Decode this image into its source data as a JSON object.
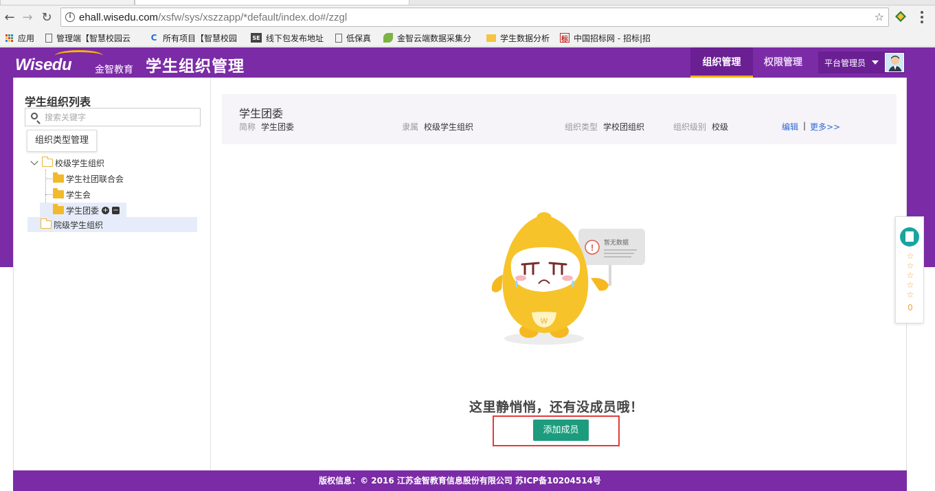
{
  "browser": {
    "url_host": "ehall.wisedu.com",
    "url_path": "/xsfw/sys/xszzapp/*default/index.do#/zzgl",
    "bookmarks": [
      {
        "label": "应用",
        "icon": "apps-grid-icon"
      },
      {
        "label": "管理端【智慧校园云",
        "icon": "page-icon"
      },
      {
        "label": "所有项目【智慧校园",
        "icon": "chrome-c-icon"
      },
      {
        "label": "线下包发布地址",
        "icon": "se-icon"
      },
      {
        "label": "低保真",
        "icon": "page-icon"
      },
      {
        "label": "金智云端数据采集分",
        "icon": "leaf-icon"
      },
      {
        "label": "学生数据分析",
        "icon": "folder-icon"
      },
      {
        "label": "中国招标网 - 招标|招",
        "icon": "tender-icon"
      }
    ]
  },
  "header": {
    "logo_text": "Wisedu",
    "logo_cn": "金智教育",
    "app_title": "学生组织管理",
    "nav": [
      {
        "label": "组织管理",
        "active": true
      },
      {
        "label": "权限管理",
        "active": false
      }
    ],
    "role_label": "平台管理员",
    "accent_color": "#7b2ba6",
    "highlight_color": "#f5b400"
  },
  "sidebar": {
    "title": "学生组织列表",
    "search_placeholder": "搜索关键字",
    "type_button": "组织类型管理",
    "tree": [
      {
        "label": "校级学生组织",
        "level": 0,
        "expanded": true
      },
      {
        "label": "学生社团联合会",
        "level": 1
      },
      {
        "label": "学生会",
        "level": 1
      },
      {
        "label": "学生团委",
        "level": 1,
        "selected": true
      },
      {
        "label": "院级学生组织",
        "level": 0,
        "expanded": false
      }
    ]
  },
  "info": {
    "title": "学生团委",
    "fields": [
      {
        "key": "简称",
        "value": "学生团委"
      },
      {
        "key": "隶属",
        "value": "校级学生组织"
      },
      {
        "key": "组织类型",
        "value": "学校团组织"
      },
      {
        "key": "组织级别",
        "value": "校级"
      }
    ],
    "edit_link": "编辑",
    "separator": "|",
    "more_link": "更多>>"
  },
  "empty": {
    "sign_text": "暂无数据",
    "mascot_letter": "W",
    "message": "这里静悄悄，还有没成员哦！",
    "add_button": "添加成员",
    "button_color": "#1c9c7d"
  },
  "footer": {
    "text": "版权信息：© 2016 江苏金智教育信息股份有限公司 苏ICP备10204514号"
  },
  "widget": {
    "stars": "☆☆☆☆☆",
    "count": "0"
  }
}
